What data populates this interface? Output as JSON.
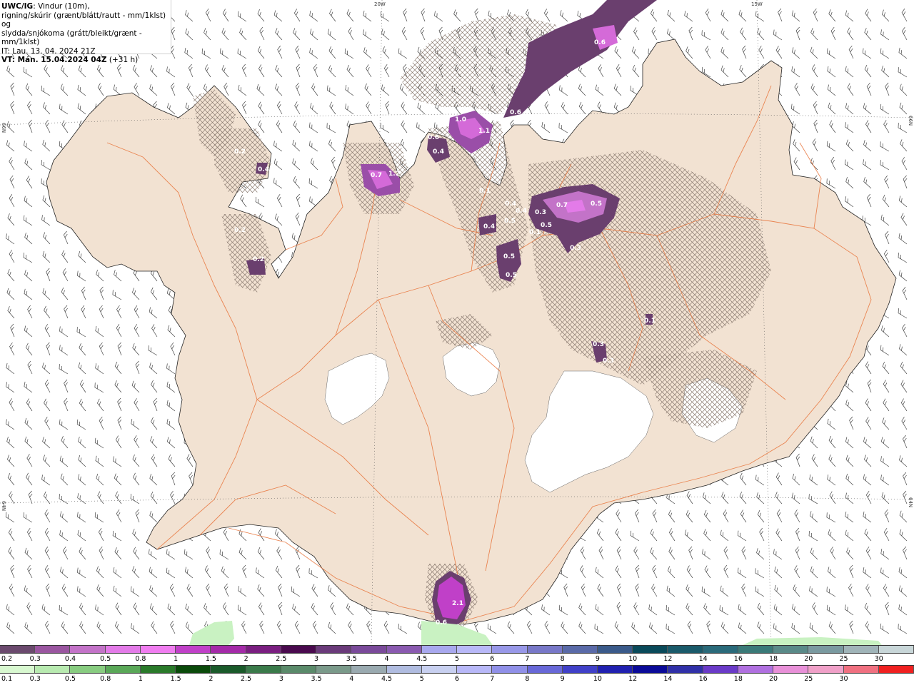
{
  "header": {
    "line1_bold": "UWC/IG",
    "line1_rest": ": Vindur (10m),",
    "line2": "rigning/skúrir (grænt/blátt/rautt - mm/1klst) og",
    "line3": "slydda/snjókoma (grátt/bleikt/grænt - mm/1klst)",
    "line4": "IT: Lau. 13. 04. 2024 21Z",
    "line5_bold": "VT: Mán. 15.04.2024 04Z",
    "line5_rest": " (+31 h)"
  },
  "graticule": {
    "lon_labels": [
      "20W",
      "15W"
    ],
    "lat_labels_left": [
      "66N",
      "64N"
    ],
    "lat_labels_right": [
      "66N",
      "64N"
    ]
  },
  "colors": {
    "land": "#f2e2d2",
    "sea": "#ffffff",
    "roads": "#e8743b",
    "hatch": "#8a7a70",
    "precip_dark": "#6a3f6e",
    "precip_mid": "#9a4ea8",
    "precip_light": "#d46ad8",
    "precip_green": "#c9f2c2",
    "wind_barb": "#444444"
  },
  "precip_labels": [
    "0.6",
    "0.6",
    "1.0",
    "1.1",
    "0.4",
    "0.6",
    "0.4",
    "0.2",
    "0.7",
    "1.2",
    "0.2",
    "0.2",
    "0.4",
    "0.7",
    "0.5",
    "0.4",
    "0.3",
    "0.4",
    "0.5",
    "0.5",
    "0.3",
    "0.5",
    "0.5",
    "0.1",
    "0.3",
    "0.1",
    "0.3",
    "0.1",
    "2.1",
    "0.6"
  ],
  "colorbar_snow": {
    "colors": [
      "#6b4a6e",
      "#9a56a0",
      "#c373c8",
      "#e37be8",
      "#f07df0",
      "#c040c8",
      "#a42aa8",
      "#7a1e80",
      "#4a0a4e",
      "#6a3a7a",
      "#7a4a9a",
      "#8a5ab0",
      "#a8a8ee",
      "#b8b8f8",
      "#9898e8",
      "#7878c8",
      "#5a6aa8",
      "#3a5a8a",
      "#0a4a5a",
      "#1a5a6a",
      "#2a6a7a",
      "#3a7a78",
      "#5a8a88",
      "#7a9aa0",
      "#a0b4b8",
      "#c8d6d8"
    ],
    "labels": [
      "0.2",
      "0.3",
      "0.4",
      "0.5",
      "0.8",
      "1",
      "1.5",
      "2",
      "2.5",
      "3",
      "3.5",
      "4",
      "4.5",
      "5",
      "6",
      "7",
      "8",
      "9",
      "10",
      "12",
      "14",
      "16",
      "18",
      "20",
      "25",
      "30"
    ]
  },
  "colorbar_rain": {
    "colors": [
      "#d8f8d0",
      "#b8eab0",
      "#88cc80",
      "#5aa858",
      "#2a7a2a",
      "#0a4a0a",
      "#1a5a2a",
      "#3a7a4a",
      "#5a8a6a",
      "#7a9a8a",
      "#9aaab0",
      "#b0bce0",
      "#c8d0f0",
      "#b8b8f8",
      "#9090e8",
      "#6868d8",
      "#4040c8",
      "#2020b0",
      "#0a0a98",
      "#3030a8",
      "#6a3ac8",
      "#b070e0",
      "#e890d8",
      "#f0a0c8",
      "#f07080",
      "#f02020"
    ],
    "labels": [
      "0.1",
      "0.3",
      "0.5",
      "0.8",
      "1",
      "1.5",
      "2",
      "2.5",
      "3",
      "3.5",
      "4",
      "4.5",
      "5",
      "6",
      "7",
      "8",
      "9",
      "10",
      "12",
      "14",
      "16",
      "18",
      "20",
      "25",
      "30"
    ]
  }
}
